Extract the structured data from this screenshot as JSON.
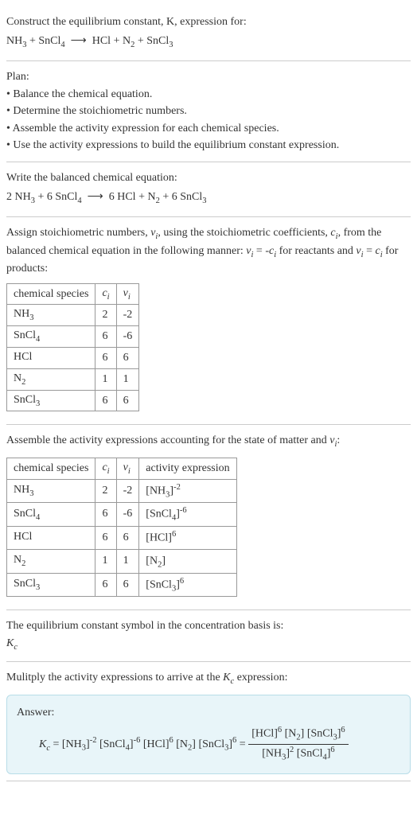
{
  "s1": {
    "l1": "Construct the equilibrium constant, K, expression for:"
  },
  "s2": {
    "l1": "Plan:",
    "b1": "• Balance the chemical equation.",
    "b2": "• Determine the stoichiometric numbers.",
    "b3": "• Assemble the activity expression for each chemical species.",
    "b4": "• Use the activity expressions to build the equilibrium constant expression."
  },
  "s3": {
    "l1": "Write the balanced chemical equation:"
  },
  "s5": {
    "l1": "The equilibrium constant symbol in the concentration basis is:"
  },
  "s6": {
    "l1": "Mulitply the activity expressions to arrive at the Kc expression:",
    "answer": "Answer:"
  },
  "t1": {
    "h1": "chemical species",
    "r1": {
      "sp": "NH",
      "sub": "3",
      "c": "2",
      "v": "-2"
    },
    "r2": {
      "sp": "SnCl",
      "sub": "4",
      "c": "6",
      "v": "-6"
    },
    "r3": {
      "sp": "HCl",
      "sub": "",
      "c": "6",
      "v": "6"
    },
    "r4": {
      "sp": "N",
      "sub": "2",
      "c": "1",
      "v": "1"
    },
    "r5": {
      "sp": "SnCl",
      "sub": "3",
      "c": "6",
      "v": "6"
    }
  },
  "t2": {
    "h1": "chemical species",
    "h4": "activity expression",
    "r1": {
      "sp": "NH",
      "sub": "3",
      "c": "2",
      "v": "-2",
      "asp": "NH",
      "asub": "3",
      "aexp": "-2"
    },
    "r2": {
      "sp": "SnCl",
      "sub": "4",
      "c": "6",
      "v": "-6",
      "asp": "SnCl",
      "asub": "4",
      "aexp": "-6"
    },
    "r3": {
      "sp": "HCl",
      "sub": "",
      "c": "6",
      "v": "6",
      "asp": "HCl",
      "asub": "",
      "aexp": "6"
    },
    "r4": {
      "sp": "N",
      "sub": "2",
      "c": "1",
      "v": "1",
      "asp": "N",
      "asub": "2",
      "aexp": ""
    },
    "r5": {
      "sp": "SnCl",
      "sub": "3",
      "c": "6",
      "v": "6",
      "asp": "SnCl",
      "asub": "3",
      "aexp": "6"
    }
  },
  "chart_data": {
    "type": "table",
    "title": "Stoichiometric and activity data for equilibrium constant construction",
    "reaction_unbalanced": "NH3 + SnCl4 -> HCl + N2 + SnCl3",
    "reaction_balanced": "2 NH3 + 6 SnCl4 -> 6 HCl + N2 + 6 SnCl3",
    "species": [
      {
        "name": "NH3",
        "c_i": 2,
        "nu_i": -2,
        "activity": "[NH3]^-2"
      },
      {
        "name": "SnCl4",
        "c_i": 6,
        "nu_i": -6,
        "activity": "[SnCl4]^-6"
      },
      {
        "name": "HCl",
        "c_i": 6,
        "nu_i": 6,
        "activity": "[HCl]^6"
      },
      {
        "name": "N2",
        "c_i": 1,
        "nu_i": 1,
        "activity": "[N2]"
      },
      {
        "name": "SnCl3",
        "c_i": 6,
        "nu_i": 6,
        "activity": "[SnCl3]^6"
      }
    ],
    "Kc_expression": "[HCl]^6 [N2] [SnCl3]^6 / ([NH3]^2 [SnCl4]^6)"
  }
}
